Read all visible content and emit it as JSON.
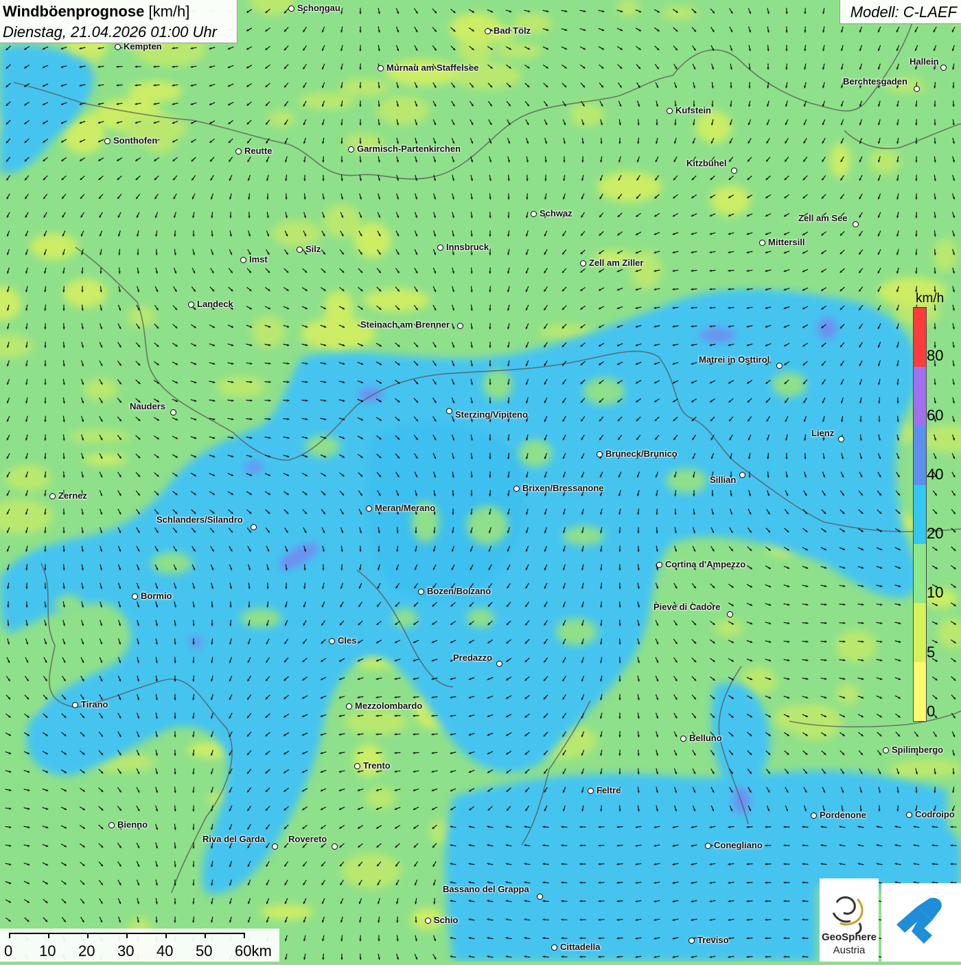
{
  "header": {
    "title_bold": "Windböenprognose",
    "title_unit": "[km/h]",
    "datetime": "Dienstag, 21.04.2026 01:00 Uhr",
    "model": "Modell: C-LAEF"
  },
  "legend": {
    "unit": "km/h",
    "ticks": [
      "80",
      "60",
      "40",
      "20",
      "10",
      "5",
      "0"
    ],
    "colors": [
      "#ff3b3b",
      "#a070ee",
      "#5d8ff0",
      "#33c7f2",
      "#8ee88c",
      "#d8f25c",
      "#fff970"
    ]
  },
  "scale": {
    "labels": [
      "0",
      "10",
      "20",
      "30",
      "40",
      "50",
      "60km"
    ]
  },
  "logos": {
    "geosphere_line1": "GeoSphere",
    "geosphere_line2": "Austria"
  },
  "cities": [
    {
      "name": "Schongau"
    },
    {
      "name": "Kempten"
    },
    {
      "name": "Bad Tölz"
    },
    {
      "name": "Hallein"
    },
    {
      "name": "Murnau am Staffelsee"
    },
    {
      "name": "Berchtesgaden"
    },
    {
      "name": "Kufstein"
    },
    {
      "name": "Sonthofen"
    },
    {
      "name": "Reutte"
    },
    {
      "name": "Garmisch-Partenkirchen"
    },
    {
      "name": "Kitzbühel"
    },
    {
      "name": "Schwaz"
    },
    {
      "name": "Zell am See"
    },
    {
      "name": "Mittersill"
    },
    {
      "name": "Innsbruck"
    },
    {
      "name": "Silz"
    },
    {
      "name": "Imst"
    },
    {
      "name": "Zell am Ziller"
    },
    {
      "name": "Landeck"
    },
    {
      "name": "Steinach am Brenner"
    },
    {
      "name": "Matrei in Osttirol"
    },
    {
      "name": "Nauders"
    },
    {
      "name": "Sterzing/Vipiteno"
    },
    {
      "name": "Lienz"
    },
    {
      "name": "Bruneck/Brunico"
    },
    {
      "name": "Sillian"
    },
    {
      "name": "Brixen/Bressanone"
    },
    {
      "name": "Zernez"
    },
    {
      "name": "Meran/Merano"
    },
    {
      "name": "Schlanders/Silandro"
    },
    {
      "name": "Cortina d'Ampezzo"
    },
    {
      "name": "Bozen/Bolzano"
    },
    {
      "name": "Bormio"
    },
    {
      "name": "Pieve di Cadore"
    },
    {
      "name": "Cles"
    },
    {
      "name": "Predazzo"
    },
    {
      "name": "Tirano"
    },
    {
      "name": "Mezzolombardo"
    },
    {
      "name": "Belluno"
    },
    {
      "name": "Spilimbergo"
    },
    {
      "name": "Trento"
    },
    {
      "name": "Feltre"
    },
    {
      "name": "Bienno"
    },
    {
      "name": "Pordenone"
    },
    {
      "name": "Codroipo"
    },
    {
      "name": "Riva del Garda"
    },
    {
      "name": "Rovereto"
    },
    {
      "name": "Conegliano"
    },
    {
      "name": "Bassano del Grappa"
    },
    {
      "name": "Schio"
    },
    {
      "name": "Treviso"
    },
    {
      "name": "Cittadella"
    }
  ]
}
